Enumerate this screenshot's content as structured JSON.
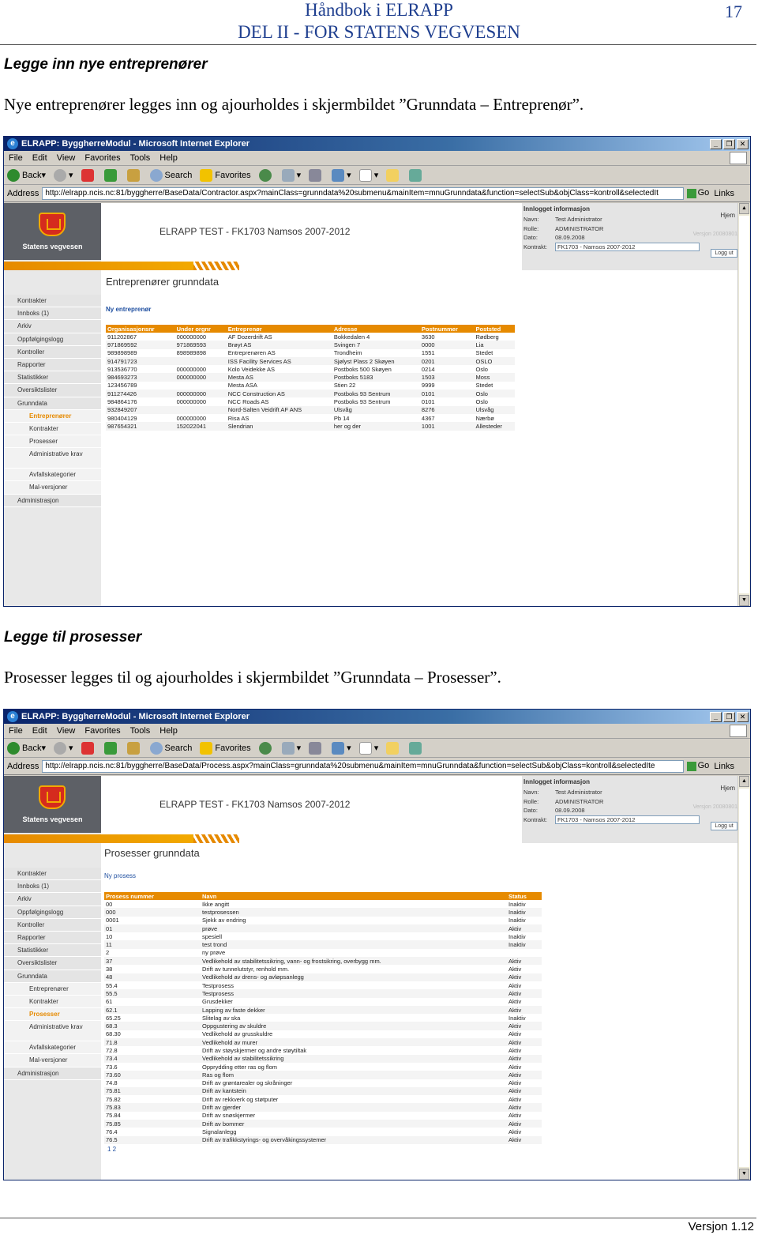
{
  "header": {
    "line1": "Håndbok i ELRAPP",
    "line2": "DEL II - FOR STATENS VEGVESEN",
    "page_number": "17"
  },
  "section1": {
    "heading": "Legge inn nye entreprenører",
    "text": "Nye entreprenører legges inn og ajourholdes i skjermbildet ”Grunndata – Entreprenør”."
  },
  "section2": {
    "heading": "Legge til prosesser",
    "text": "Prosesser legges til og ajourholdes i skjermbildet ”Grunndata – Prosesser”."
  },
  "footer": {
    "version": "Versjon 1.12"
  },
  "browser": {
    "title": "ELRAPP: ByggherreModul - Microsoft Internet Explorer",
    "menu": [
      "File",
      "Edit",
      "View",
      "Favorites",
      "Tools",
      "Help"
    ],
    "back": "Back",
    "search": "Search",
    "favorites": "Favorites",
    "address_label": "Address",
    "go": "Go",
    "links": "Links"
  },
  "shot1": {
    "url": "http://elrapp.ncis.nc:81/byggherre/BaseData/Contractor.aspx?mainClass=grunndata%20submenu&mainItem=mnuGrunndata&function=selectSub&objClass=kontroll&selectedIt",
    "page_title": "Entreprenører grunndata",
    "new_link": "Ny entreprenør",
    "columns": [
      "Organisasjonsnr",
      "Under orgnr",
      "Entreprenør",
      "Adresse",
      "Postnummer",
      "Poststed"
    ],
    "rows": [
      [
        "911202867",
        "000000000",
        "AF Dozerdrift AS",
        "Bokkedalen 4",
        "3630",
        "Rødberg"
      ],
      [
        "971869592",
        "971869593",
        "Brøyt AS",
        "Svingen 7",
        "0000",
        "Lia"
      ],
      [
        "989898989",
        "898989898",
        "Entreprenøren AS",
        "Trondheim",
        "1551",
        "Stedet"
      ],
      [
        "914791723",
        "",
        "ISS Facility Services AS",
        "Sjølyst Plass 2 Skøyen",
        "0201",
        "OSLO"
      ],
      [
        "913536770",
        "000000000",
        "Kolo Veidekke AS",
        "Postboks 500 Skøyen",
        "0214",
        "Oslo"
      ],
      [
        "984693273",
        "000000000",
        "Mesta AS",
        "Postboks 5183",
        "1503",
        "Moss"
      ],
      [
        "123456789",
        "",
        "Mesta ASA",
        "Stien 22",
        "9999",
        "Stedet"
      ],
      [
        "911274426",
        "000000000",
        "NCC Construction AS",
        "Postboks 93 Sentrum",
        "0101",
        "Oslo"
      ],
      [
        "984864176",
        "000000000",
        "NCC Roads AS",
        "Postboks 93 Sentrum",
        "0101",
        "Oslo"
      ],
      [
        "932849207",
        "",
        "Nord-Salten Veidrift AF ANS",
        "Ulsvåg",
        "8276",
        "Ulsvåg"
      ],
      [
        "980404129",
        "000000000",
        "Risa AS",
        "Pb 14",
        "4367",
        "Nærbø"
      ],
      [
        "987654321",
        "152022041",
        "Slendrian",
        "her og der",
        "1001",
        "Allesteder"
      ]
    ]
  },
  "shot2": {
    "url": "http://elrapp.ncis.nc:81/byggherre/BaseData/Process.aspx?mainClass=grunndata%20submenu&mainItem=mnuGrunndata&function=selectSub&objClass=kontroll&selectedIte",
    "page_title": "Prosesser grunndata",
    "new_link": "Ny prosess",
    "columns": [
      "Prosess nummer",
      "Navn",
      "Status"
    ],
    "rows": [
      [
        "00",
        "Ikke angitt",
        "Inaktiv"
      ],
      [
        "000",
        "testprosessen",
        "Inaktiv"
      ],
      [
        "0001",
        "Sjekk av endring",
        "Inaktiv"
      ],
      [
        "01",
        "prøve",
        "Aktiv"
      ],
      [
        "10",
        "spesiell",
        "Inaktiv"
      ],
      [
        "11",
        "test trond",
        "Inaktiv"
      ],
      [
        "2",
        "ny prøve",
        ""
      ],
      [
        "37",
        "Vedlikehold av stabilitetssikring, vann- og frostsikring, overbygg mm.",
        "Aktiv"
      ],
      [
        "38",
        "Drift av tunnelutstyr, renhold mm.",
        "Aktiv"
      ],
      [
        "48",
        "Vedlikehold av drens- og avløpsanlegg",
        "Aktiv"
      ],
      [
        "55.4",
        "Testprosess",
        "Aktiv"
      ],
      [
        "55.5",
        "Testprosess",
        "Aktiv"
      ],
      [
        "61",
        "Grusdekker",
        "Aktiv"
      ],
      [
        "62.1",
        "Lapping av faste dekker",
        "Aktiv"
      ],
      [
        "65.25",
        "Slitelag av ska",
        "Inaktiv"
      ],
      [
        "68.3",
        "Oppgustering av skuldre",
        "Aktiv"
      ],
      [
        "68.30",
        "Vedlikehold av grusskuldre",
        "Aktiv"
      ],
      [
        "71.8",
        "Vedlikehold av murer",
        "Aktiv"
      ],
      [
        "72.8",
        "Drift av støyskjermer og andre støytiltak",
        "Aktiv"
      ],
      [
        "73.4",
        "Vedlikehold av stabilitetssikring",
        "Aktiv"
      ],
      [
        "73.6",
        "Opprydding etter ras og flom",
        "Aktiv"
      ],
      [
        "73.60",
        "Ras og flom",
        "Aktiv"
      ],
      [
        "74.8",
        "Drift av grøntarealer og skråninger",
        "Aktiv"
      ],
      [
        "75.81",
        "Drift av kantstein",
        "Aktiv"
      ],
      [
        "75.82",
        "Drift av rekkverk og støtputer",
        "Aktiv"
      ],
      [
        "75.83",
        "Drift av gjerder",
        "Aktiv"
      ],
      [
        "75.84",
        "Drift av snøskjermer",
        "Aktiv"
      ],
      [
        "75.85",
        "Drift av bommer",
        "Aktiv"
      ],
      [
        "76.4",
        "Signalanlegg",
        "Aktiv"
      ],
      [
        "76.5",
        "Drift av trafikkstyrings- og overvåkingssystemer",
        "Aktiv"
      ]
    ],
    "pager": "1 2"
  },
  "app": {
    "logo_text": "Statens vegvesen",
    "env_title": "ELRAPP TEST - FK1703 Namsos 2007-2012",
    "info_heading": "Innlogget informasjon",
    "hjem": "Hjem",
    "navn_label": "Navn:",
    "navn": "Test Administrator",
    "rolle_label": "Rolle:",
    "rolle": "ADMINISTRATOR",
    "dato_label": "Dato:",
    "dato": "08.09.2008",
    "kontrakt_label": "Kontrakt:",
    "kontrakt": "FK1703 - Namsos 2007-2012",
    "versjon": "Versjon 20080801",
    "logg_ut": "Logg ut",
    "nav_top": [
      "Kontrakter",
      "Innboks (1)",
      "Arkiv",
      "Oppfølgingslogg",
      "Kontroller",
      "Rapporter",
      "Statistikker",
      "Oversiktslister",
      "Grunndata"
    ],
    "nav_sub": [
      "Entreprenører",
      "Kontrakter",
      "Prosesser",
      "Administrative krav",
      "Avfallskategorier",
      "Mal-versjoner"
    ],
    "nav_last": "Administrasjon"
  },
  "colors": {
    "orange": "#e68a00",
    "title_blue": "#0a246a",
    "header_blue": "#1f3f8f"
  }
}
